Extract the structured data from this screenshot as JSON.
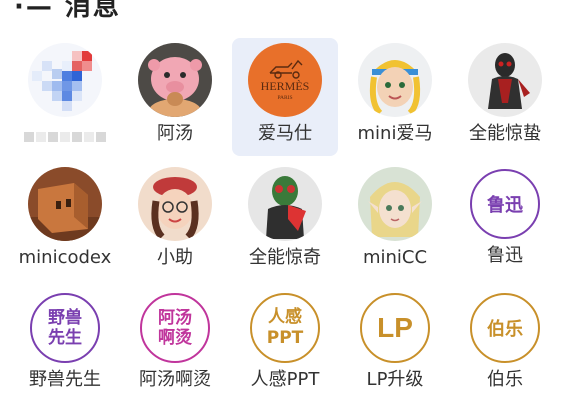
{
  "header": {
    "partial_title": "·— 消息"
  },
  "colors": {
    "selected_bg": "#e9eef9",
    "purple": "#7a3fb0",
    "magenta": "#c0359c",
    "gold": "#c8902a"
  },
  "contacts": [
    [
      {
        "label": "",
        "avatar": "pixelated-avatar",
        "blurred": true
      },
      {
        "label": "阿汤",
        "avatar": "pink-plush-avatar"
      },
      {
        "label": "爱马仕",
        "avatar": "hermes-logo-avatar",
        "selected": true,
        "logo_text": "HERMÈS",
        "logo_sub": "PARIS"
      },
      {
        "label": "mini爱马",
        "avatar": "cartoon-girl-avatar"
      },
      {
        "label": "全能惊蛰",
        "avatar": "armored-hero-avatar"
      }
    ],
    [
      {
        "label": "minicodex",
        "avatar": "brown-box-avatar"
      },
      {
        "label": "小助",
        "avatar": "beret-girl-avatar"
      },
      {
        "label": "全能惊奇",
        "avatar": "masked-rider-avatar"
      },
      {
        "label": "miniCC",
        "avatar": "elf-girl-avatar"
      },
      {
        "label": "鲁迅",
        "avatar": "text-avatar",
        "avatar_text": "鲁迅",
        "color": "#7a3fb0"
      }
    ],
    [
      {
        "label": "野兽先生",
        "avatar": "text-avatar",
        "avatar_text": "野兽先生",
        "color": "#7a3fb0"
      },
      {
        "label": "阿汤啊烫",
        "avatar": "text-avatar",
        "avatar_text": "阿汤啊烫",
        "color": "#c0359c"
      },
      {
        "label": "人感PPT",
        "avatar": "text-avatar",
        "avatar_text_line1": "人感",
        "avatar_text_line2": "PPT",
        "color": "#c8902a"
      },
      {
        "label": "LP升级",
        "avatar": "text-avatar",
        "avatar_text": "LP",
        "color": "#c8902a"
      },
      {
        "label": "伯乐",
        "avatar": "text-avatar",
        "avatar_text": "伯乐",
        "color": "#c8902a"
      }
    ]
  ]
}
